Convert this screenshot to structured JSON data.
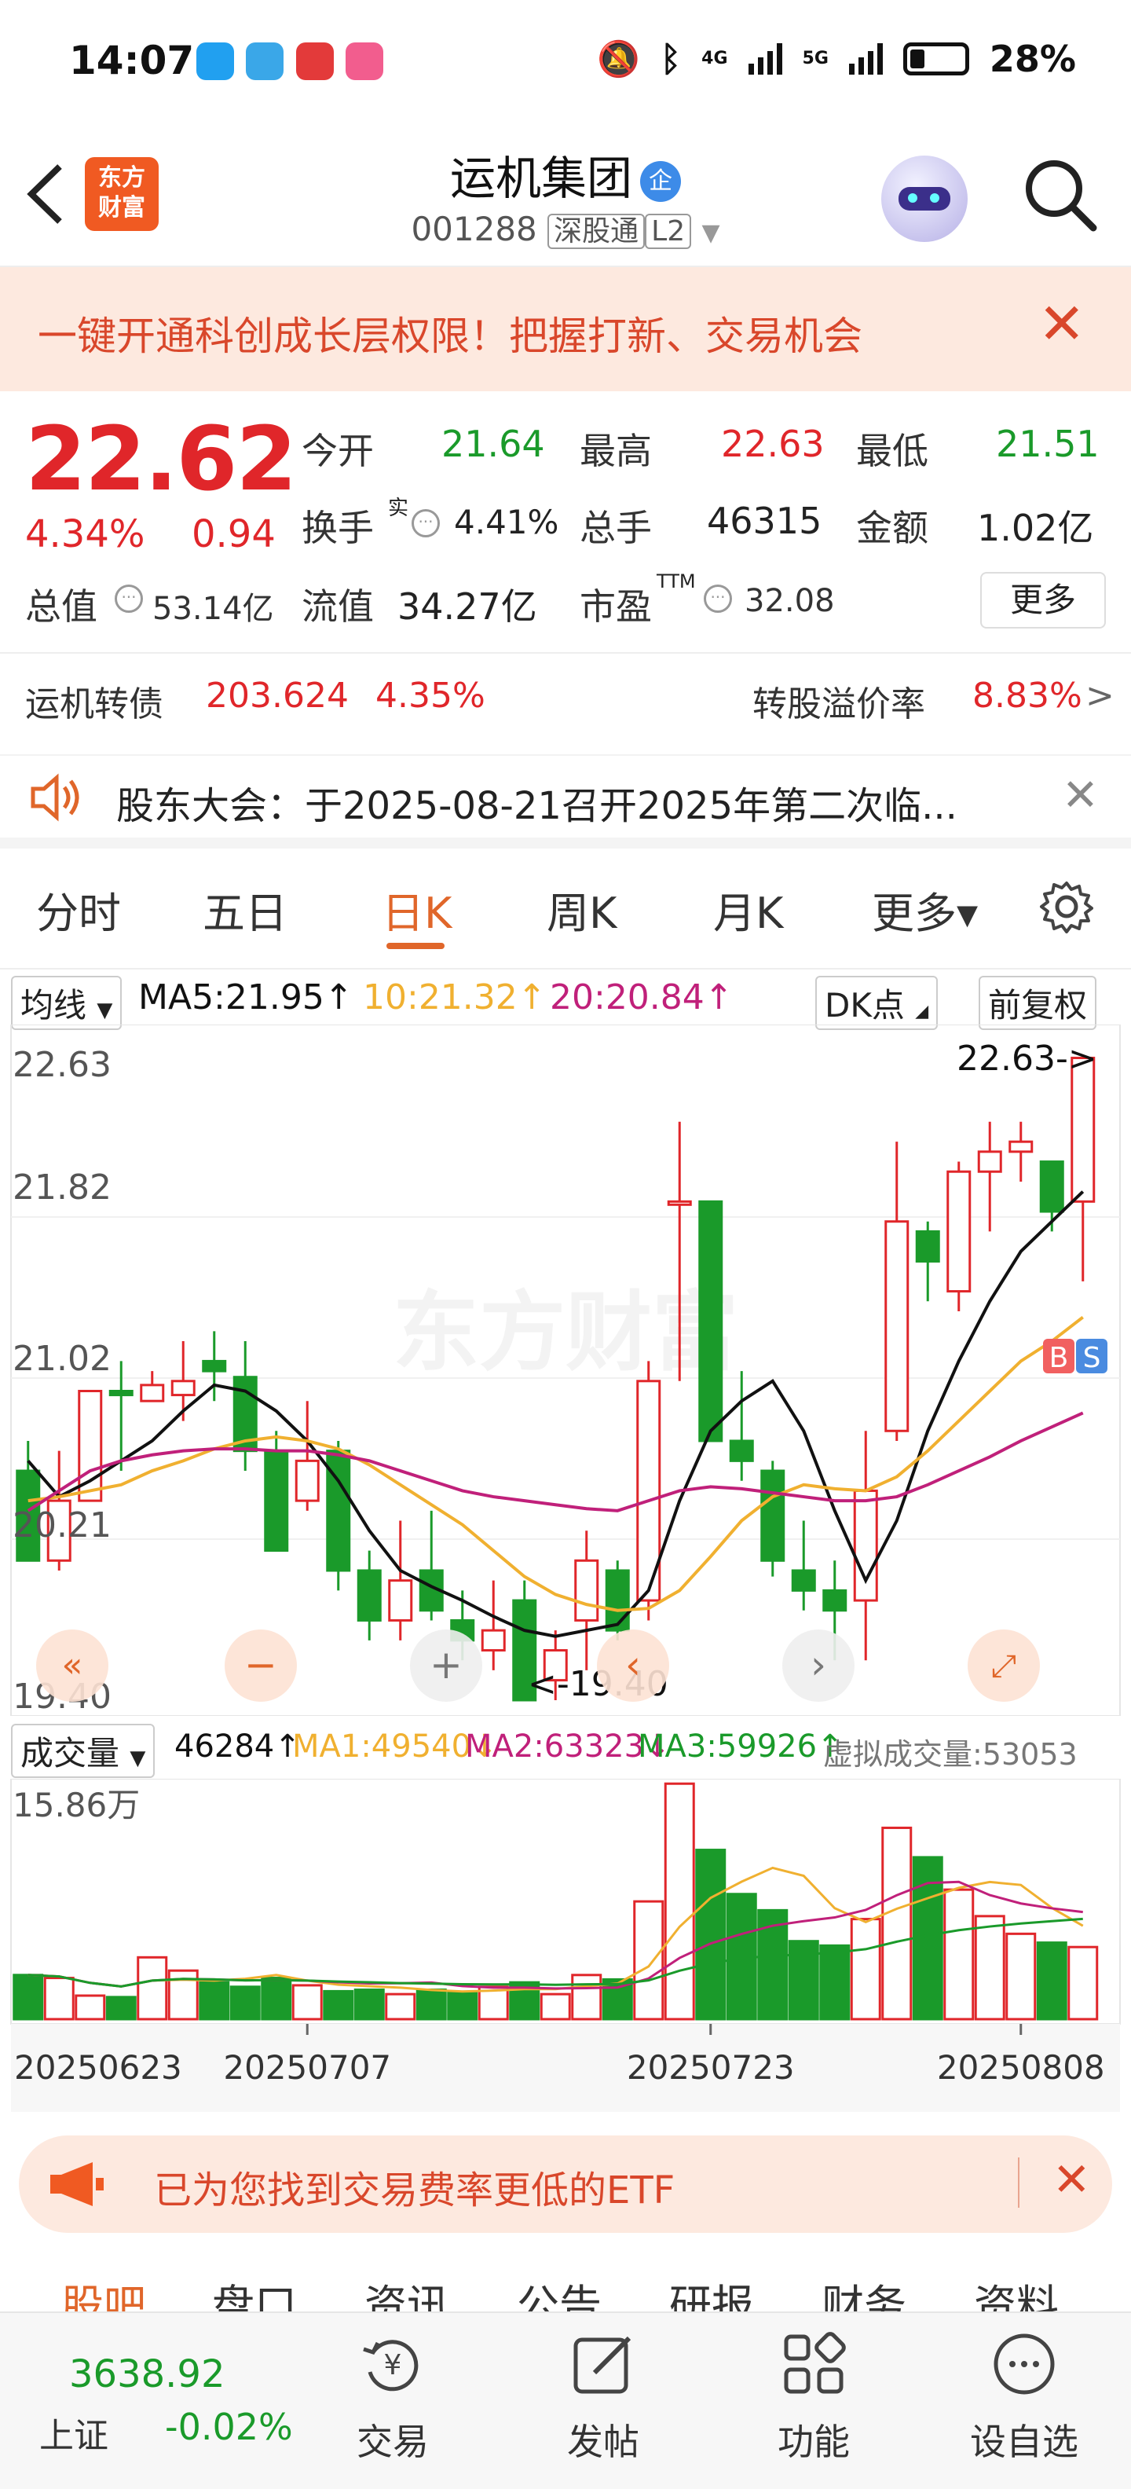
{
  "status_bar": {
    "time": "14:07",
    "network": "4G",
    "network2": "5G",
    "battery": "28%"
  },
  "header": {
    "back_icon": "back-arrow-icon",
    "logo_text_1": "东方",
    "logo_text_2": "财富",
    "stock_name": "运机集团",
    "badge": "企",
    "stock_code": "001288",
    "tag_market": "深股通",
    "tag_level": "L2"
  },
  "banner": {
    "text": "一键开通科创成长层权限！把握打新、交易机会"
  },
  "quote": {
    "price": "22.62",
    "change_pct": "4.34%",
    "change": "0.94",
    "open_label": "今开",
    "open": "21.64",
    "high_label": "最高",
    "high": "22.63",
    "low_label": "最低",
    "low": "21.51",
    "turnover_label": "换手",
    "turnover_sup": "实",
    "turnover": "4.41%",
    "volume_label": "总手",
    "volume": "46315",
    "amount_label": "金额",
    "amount": "1.02亿",
    "mktcap_label": "总值",
    "mktcap": "53.14亿",
    "float_label": "流值",
    "float": "34.27亿",
    "pe_label": "市盈",
    "pe_sup": "TTM",
    "pe": "32.08",
    "more": "更多"
  },
  "bond": {
    "name": "运机转债",
    "price": "203.624",
    "pct": "4.35%",
    "premium_label": "转股溢价率",
    "premium": "8.83%",
    "arrow": ">"
  },
  "notice": {
    "text": "股东大会：于2025-08-21召开2025年第二次临..."
  },
  "tabs": [
    "分时",
    "五日",
    "日K",
    "周K",
    "月K",
    "更多▾"
  ],
  "active_tab": "日K",
  "ma_row": {
    "selector": "均线",
    "ma5": "MA5:21.95↑",
    "ma10": "10:21.32↑",
    "ma20": "20:20.84↑",
    "dk": "DK点",
    "fq": "前复权"
  },
  "chart_labels": {
    "y_top": "22.63",
    "y_2": "21.82",
    "y_3": "21.02",
    "y_4": "20.21",
    "y_bottom": "19.40",
    "max_marker": "22.63->",
    "min_marker": "<-19.40",
    "b_marker": "B",
    "s_marker": "S"
  },
  "volume_row": {
    "selector": "成交量",
    "vol": "46284↑",
    "ma1": "MA1:49540↓",
    "ma2": "MA2:63323↓",
    "ma3": "MA3:59926↑",
    "virtual": "虚拟成交量:53053",
    "y_top": "15.86万"
  },
  "dates": [
    "20250623",
    "20250707",
    "20250723",
    "20250808"
  ],
  "etf": {
    "text": "已为您找到交易费率更低的ETF"
  },
  "subtabs": [
    "股吧",
    "盘口",
    "资讯",
    "公告",
    "研报",
    "财务",
    "资料"
  ],
  "bottom_nav": {
    "index_value": "3638.92",
    "index_name": "上证",
    "index_change": "-0.02%",
    "trade": "交易",
    "post": "发帖",
    "func": "功能",
    "watch": "设自选"
  },
  "colors": {
    "up": "#e0262a",
    "down": "#1a9a2a",
    "accent": "#e0662a",
    "ma5": "#111111",
    "ma10": "#f0b030",
    "ma20": "#c0207a"
  },
  "chart_data": {
    "type": "candlestick",
    "ylim": [
      19.4,
      22.63
    ],
    "candles": [
      {
        "o": 20.55,
        "h": 20.7,
        "l": 20.1,
        "c": 20.1
      },
      {
        "o": 20.1,
        "h": 20.65,
        "l": 20.05,
        "c": 20.4
      },
      {
        "o": 20.4,
        "h": 20.95,
        "l": 20.4,
        "c": 20.95
      },
      {
        "o": 20.95,
        "h": 21.1,
        "l": 20.55,
        "c": 20.93
      },
      {
        "o": 20.9,
        "h": 21.05,
        "l": 20.9,
        "c": 20.98
      },
      {
        "o": 20.93,
        "h": 21.2,
        "l": 20.8,
        "c": 21.0
      },
      {
        "o": 21.1,
        "h": 21.25,
        "l": 20.9,
        "c": 21.05
      },
      {
        "o": 21.02,
        "h": 21.2,
        "l": 20.55,
        "c": 20.65
      },
      {
        "o": 20.65,
        "h": 20.75,
        "l": 20.15,
        "c": 20.15
      },
      {
        "o": 20.4,
        "h": 20.9,
        "l": 20.35,
        "c": 20.6
      },
      {
        "o": 20.65,
        "h": 20.7,
        "l": 19.95,
        "c": 20.05
      },
      {
        "o": 20.05,
        "h": 20.15,
        "l": 19.7,
        "c": 19.8
      },
      {
        "o": 19.8,
        "h": 20.3,
        "l": 19.7,
        "c": 20.0
      },
      {
        "o": 20.05,
        "h": 20.35,
        "l": 19.8,
        "c": 19.85
      },
      {
        "o": 19.8,
        "h": 19.95,
        "l": 19.6,
        "c": 19.7
      },
      {
        "o": 19.65,
        "h": 20.0,
        "l": 19.55,
        "c": 19.75
      },
      {
        "o": 19.9,
        "h": 20.0,
        "l": 19.5,
        "c": 19.4
      },
      {
        "o": 19.5,
        "h": 19.75,
        "l": 19.4,
        "c": 19.65
      },
      {
        "o": 19.8,
        "h": 20.25,
        "l": 19.55,
        "c": 20.1
      },
      {
        "o": 20.05,
        "h": 20.1,
        "l": 19.7,
        "c": 19.75
      },
      {
        "o": 19.9,
        "h": 21.1,
        "l": 19.8,
        "c": 21.0
      },
      {
        "o": 21.9,
        "h": 22.3,
        "l": 21.0,
        "c": 21.9
      },
      {
        "o": 21.9,
        "h": 21.9,
        "l": 20.7,
        "c": 20.7
      },
      {
        "o": 20.7,
        "h": 21.05,
        "l": 20.5,
        "c": 20.6
      },
      {
        "o": 20.55,
        "h": 20.6,
        "l": 20.02,
        "c": 20.1
      },
      {
        "o": 20.05,
        "h": 20.3,
        "l": 19.85,
        "c": 19.95
      },
      {
        "o": 19.95,
        "h": 20.1,
        "l": 19.6,
        "c": 19.85
      },
      {
        "o": 19.9,
        "h": 20.75,
        "l": 19.6,
        "c": 20.45
      },
      {
        "o": 20.75,
        "h": 22.2,
        "l": 20.7,
        "c": 21.8
      },
      {
        "o": 21.75,
        "h": 21.8,
        "l": 21.4,
        "c": 21.6
      },
      {
        "o": 21.45,
        "h": 22.1,
        "l": 21.35,
        "c": 22.05
      },
      {
        "o": 22.05,
        "h": 22.3,
        "l": 21.75,
        "c": 22.15
      },
      {
        "o": 22.15,
        "h": 22.3,
        "l": 22.0,
        "c": 22.2
      },
      {
        "o": 22.1,
        "h": 22.1,
        "l": 21.75,
        "c": 21.85
      },
      {
        "o": 21.9,
        "h": 22.6,
        "l": 21.5,
        "c": 22.62
      }
    ],
    "ma5": [
      20.6,
      20.42,
      20.5,
      20.6,
      20.7,
      20.85,
      20.98,
      20.95,
      20.85,
      20.7,
      20.5,
      20.25,
      20.05,
      19.97,
      19.9,
      19.82,
      19.75,
      19.72,
      19.75,
      19.78,
      19.95,
      20.4,
      20.75,
      20.9,
      21.0,
      20.75,
      20.35,
      20.0,
      20.3,
      20.75,
      21.1,
      21.4,
      21.65,
      21.8,
      21.95
    ],
    "ma10": [
      20.4,
      20.42,
      20.45,
      20.48,
      20.55,
      20.6,
      20.66,
      20.7,
      20.72,
      20.7,
      20.66,
      20.58,
      20.48,
      20.38,
      20.28,
      20.15,
      20.02,
      19.93,
      19.88,
      19.85,
      19.86,
      19.95,
      20.12,
      20.3,
      20.42,
      20.48,
      20.46,
      20.45,
      20.52,
      20.65,
      20.8,
      20.95,
      21.1,
      21.2,
      21.32
    ],
    "ma20": [
      20.35,
      20.45,
      20.55,
      20.6,
      20.63,
      20.65,
      20.66,
      20.66,
      20.65,
      20.65,
      20.63,
      20.6,
      20.55,
      20.5,
      20.45,
      20.42,
      20.4,
      20.38,
      20.36,
      20.35,
      20.4,
      20.45,
      20.47,
      20.46,
      20.44,
      20.42,
      20.4,
      20.4,
      20.42,
      20.48,
      20.55,
      20.62,
      20.7,
      20.77,
      20.84
    ],
    "volume": [
      30,
      28,
      16,
      15,
      42,
      33,
      25,
      22,
      28,
      23,
      19,
      20,
      17,
      20,
      18,
      22,
      25,
      17,
      30,
      27,
      80,
      160,
      115,
      85,
      74,
      53,
      50,
      68,
      130,
      110,
      88,
      70,
      58,
      52,
      49
    ],
    "volume_max": 158600
  }
}
